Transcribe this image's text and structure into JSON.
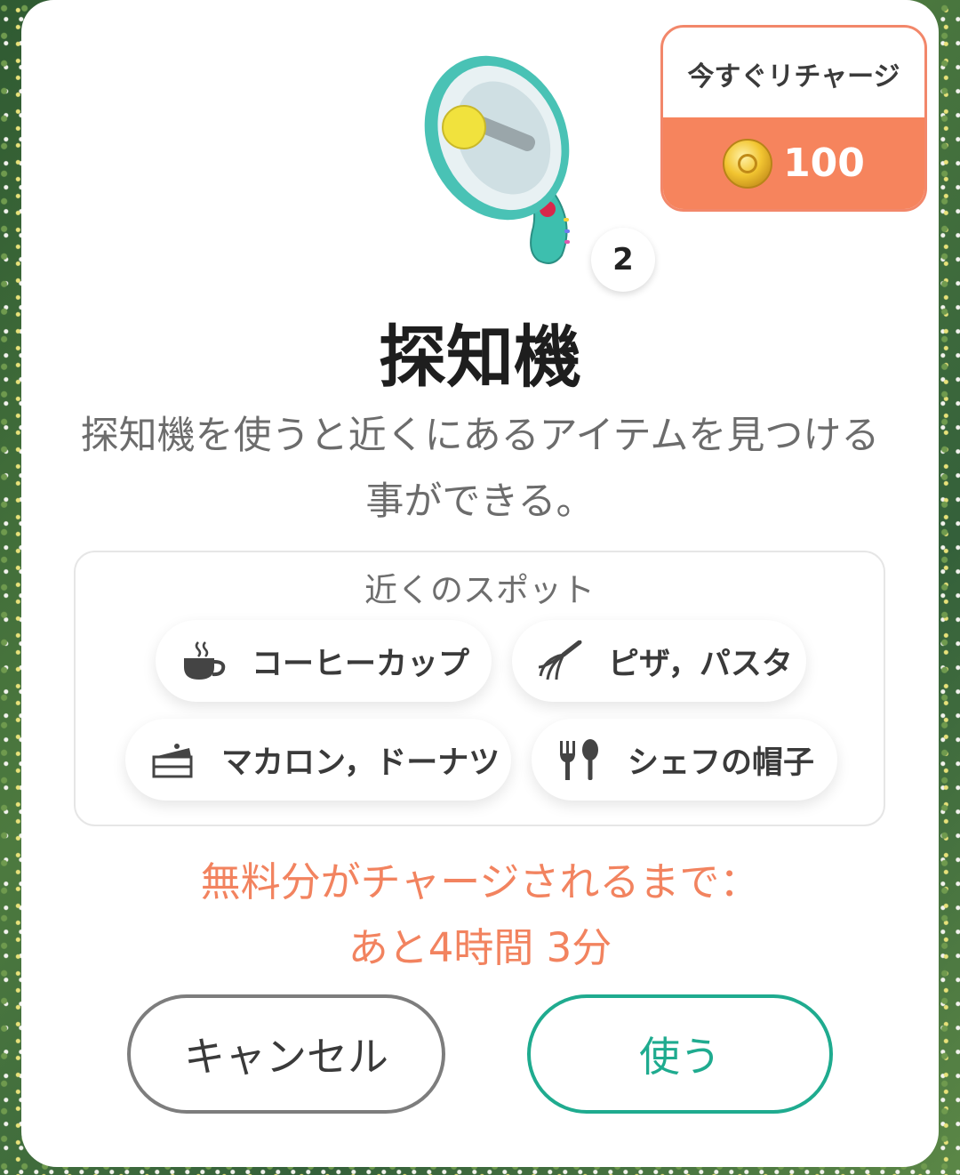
{
  "recharge": {
    "label": "今すぐリチャージ",
    "price": "100",
    "coin_icon": "gold-coin-icon"
  },
  "item": {
    "count": "2",
    "title": "探知機",
    "description": "探知機を使うと近くにあるアイテムを見つける事ができる。",
    "icon": "megaphone-detector-icon"
  },
  "nearby": {
    "title": "近くのスポット",
    "spots": [
      {
        "icon": "coffee-cup-icon",
        "label": "コーヒーカップ"
      },
      {
        "icon": "whisk-icon",
        "label": "ピザ，パスタ"
      },
      {
        "icon": "cake-slice-icon",
        "label": "マカロン，ドーナツ"
      },
      {
        "icon": "fork-spoon-icon",
        "label": "シェフの帽子"
      }
    ]
  },
  "timer": {
    "line1": "無料分がチャージされるまで：",
    "line2": "あと4時間 3分"
  },
  "buttons": {
    "cancel": "キャンセル",
    "use": "使う"
  },
  "colors": {
    "accent_orange": "#f6845d",
    "accent_green": "#1fab8f"
  }
}
